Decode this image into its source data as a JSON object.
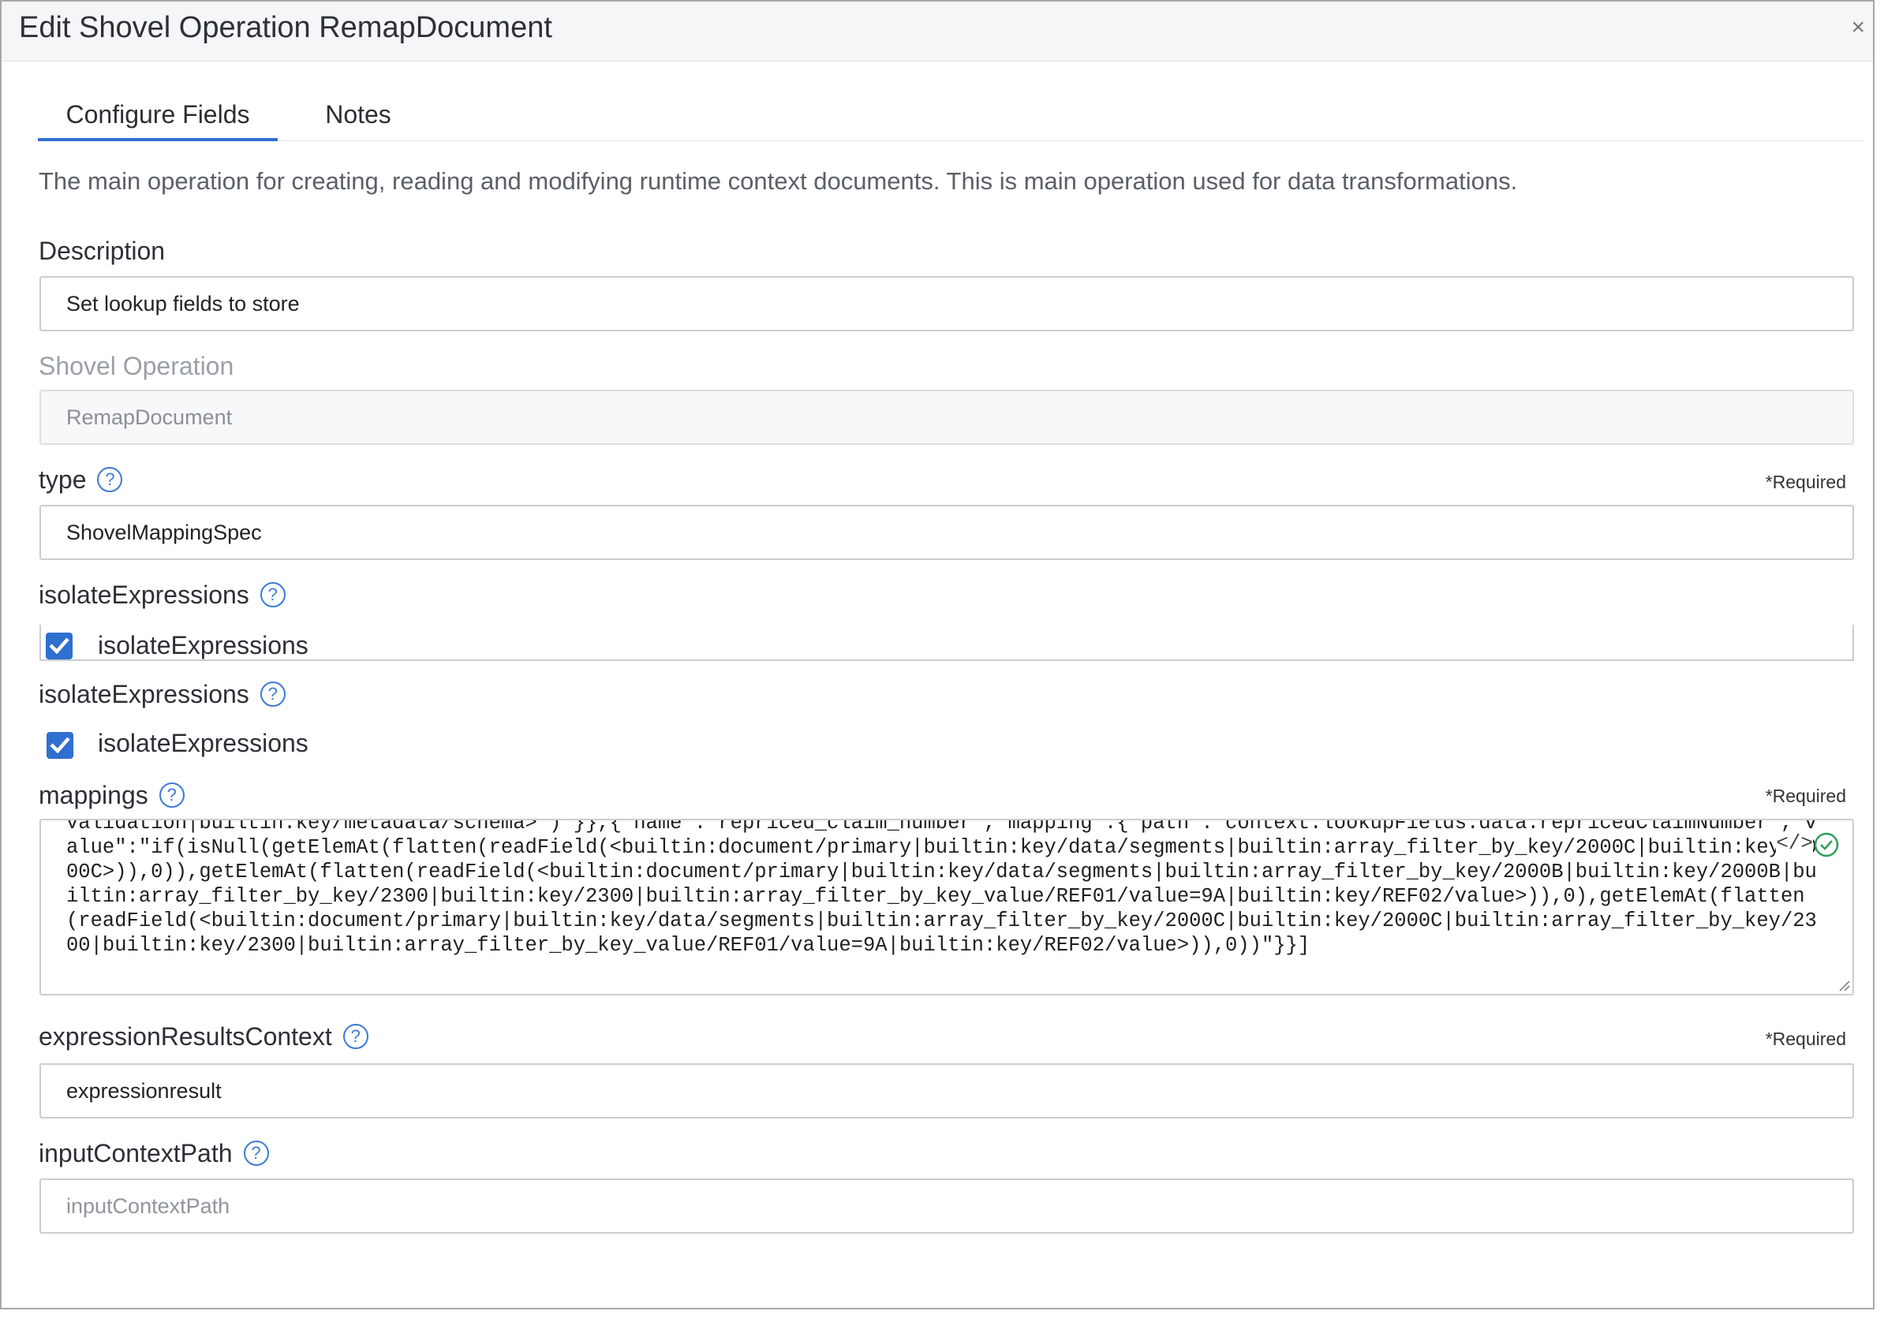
{
  "dialog": {
    "title": "Edit Shovel Operation RemapDocument",
    "close_glyph": "×"
  },
  "tabs": [
    {
      "label": "Configure Fields",
      "active": true
    },
    {
      "label": "Notes",
      "active": false
    }
  ],
  "intro_text": "The main operation for creating, reading and modifying runtime context documents. This is main operation used for data transformations.",
  "fields": {
    "description": {
      "label": "Description",
      "value": "Set lookup fields to store"
    },
    "shovel_operation": {
      "label": "Shovel Operation",
      "value": "RemapDocument"
    },
    "type": {
      "label": "type",
      "required": "*Required",
      "value": "ShovelMappingSpec"
    },
    "isolate_clipped": {
      "label": "isolateExpressions",
      "checkbox_label": "isolateExpressions",
      "checked": true
    },
    "isolate": {
      "label": "isolateExpressions",
      "checkbox_label": "isolateExpressions",
      "checked": true
    },
    "mappings": {
      "label": "mappings",
      "required": "*Required",
      "value": "validation|builtin:key/metadata/schema>\")\"}},{\"name\":\"repriced_claim_number\",\"mapping\":{\"path\":\"context.lookupFields.data.repricedClaimNumber\",\"value\":\"if(isNull(getElemAt(flatten(readField(<builtin:document/primary|builtin:key/data/segments|builtin:array_filter_by_key/2000C|builtin:key/2000C>)),0)),getElemAt(flatten(readField(<builtin:document/primary|builtin:key/data/segments|builtin:array_filter_by_key/2000B|builtin:key/2000B|builtin:array_filter_by_key/2300|builtin:key/2300|builtin:array_filter_by_key_value/REF01/value=9A|builtin:key/REF02/value>)),0),getElemAt(flatten(readField(<builtin:document/primary|builtin:key/data/segments|builtin:array_filter_by_key/2000C|builtin:key/2000C|builtin:array_filter_by_key/2300|builtin:key/2300|builtin:array_filter_by_key_value/REF01/value=9A|builtin:key/REF02/value>)),0))\"}}]",
      "code_glyph": "</>"
    },
    "expression_results_context": {
      "label": "expressionResultsContext",
      "required": "*Required",
      "value": "expressionresult"
    },
    "input_context_path": {
      "label": "inputContextPath",
      "value": "",
      "placeholder": "inputContextPath"
    }
  },
  "help_glyph": "?",
  "colors": {
    "accent": "#2f6fd0",
    "valid": "#2e9e5a"
  }
}
